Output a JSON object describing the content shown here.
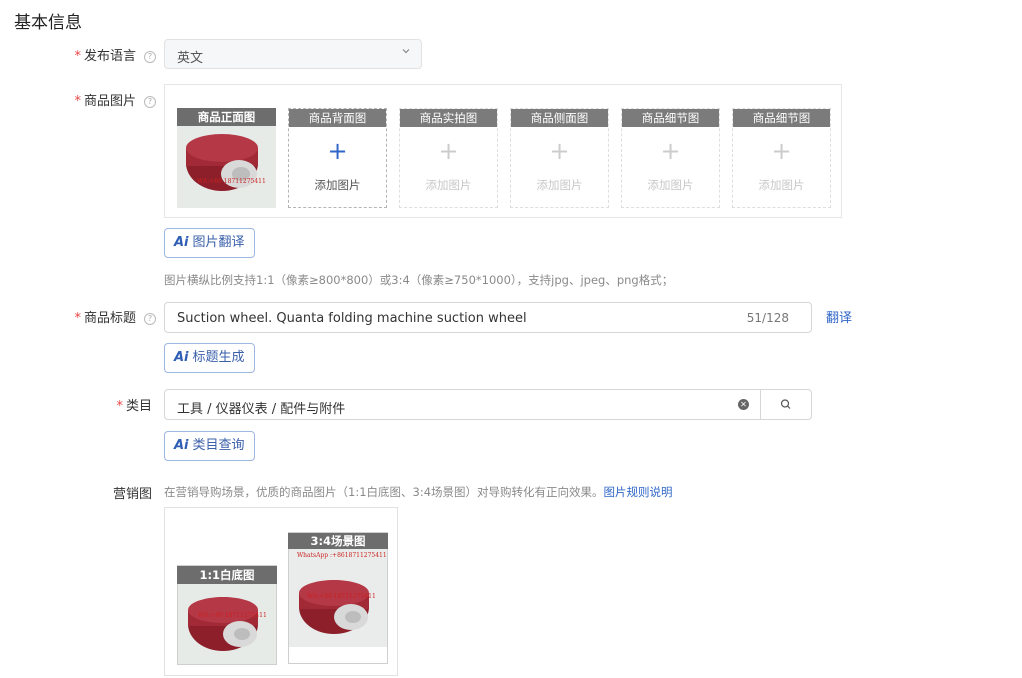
{
  "section_title": "基本信息",
  "language": {
    "label": "发布语言",
    "value": "英文"
  },
  "product_images": {
    "label": "商品图片",
    "slots": [
      {
        "caption": "商品正面图",
        "filled": true
      },
      {
        "caption": "商品背面图",
        "filled": false,
        "add_text": "添加图片"
      },
      {
        "caption": "商品实拍图",
        "filled": false,
        "add_text": "添加图片"
      },
      {
        "caption": "商品侧面图",
        "filled": false,
        "add_text": "添加图片"
      },
      {
        "caption": "商品细节图",
        "filled": false,
        "add_text": "添加图片"
      },
      {
        "caption": "商品细节图",
        "filled": false,
        "add_text": "添加图片"
      }
    ],
    "ai_button": "图片翻译",
    "hint": "图片横纵比例支持1:1（像素≥800*800）或3:4（像素≥750*1000），支持jpg、jpeg、png格式；"
  },
  "title_field": {
    "label": "商品标题",
    "value": "Suction wheel. Quanta folding machine suction wheel",
    "count": "51/128",
    "translate_link": "翻译",
    "ai_button": "标题生成"
  },
  "category": {
    "label": "类目",
    "value": "工具 / 仪器仪表 / 配件与附件",
    "ai_button": "类目查询"
  },
  "marketing": {
    "label": "营销图",
    "hint": "在营销导购场景，优质的商品图片（1:1白底图、3:4场景图）对导购转化有正向效果。",
    "rule_link": "图片规则说明",
    "images": [
      {
        "caption": "1:1白底图"
      },
      {
        "caption": "3:4场景图"
      }
    ]
  },
  "watermark_texts": {
    "whatsapp": "WhatsApp :+8618711275411",
    "wa": "WA:+86 18711275411"
  },
  "colors": {
    "accent": "#2f66c7",
    "required": "#e64545",
    "wheel": "#8c1f2a"
  }
}
